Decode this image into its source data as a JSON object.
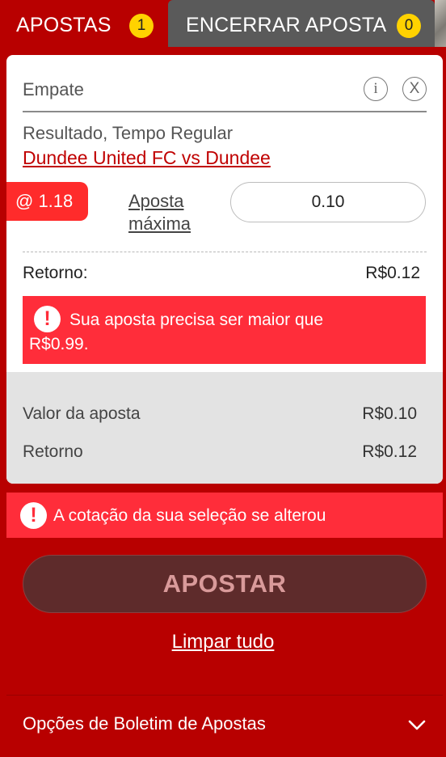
{
  "tabs": [
    {
      "label": "APOSTAS",
      "count": "1"
    },
    {
      "label": "ENCERRAR APOSTA",
      "count": "0"
    }
  ],
  "bet": {
    "selection": "Empate",
    "info_icon": "i",
    "close_icon": "X",
    "market": "Resultado, Tempo Regular",
    "event": "Dundee United FC vs Dundee",
    "odds": "@ 1.18",
    "max_bet_line1": "Aposta",
    "max_bet_line2": "máxima",
    "stake": "0.10",
    "return_label": "Retorno:",
    "return_value": "R$0.12",
    "error_line1": "Sua aposta precisa ser maior que",
    "error_line2": "R$0.99."
  },
  "summary": {
    "stake_label": "Valor da aposta",
    "stake_value": "R$0.10",
    "return_label": "Retorno",
    "return_value": "R$0.12"
  },
  "odds_banner": "A cotação da sua seleção se alterou",
  "place_bet_label": "APOSTAR",
  "clear_all_label": "Limpar tudo",
  "options_label": "Opções de Boletim de Apostas",
  "icons": {
    "exclamation": "!",
    "chevron": "chevron-down-icon",
    "info": "info-icon",
    "close": "close-icon"
  },
  "colors": {
    "brand_red": "#b80000",
    "alert_red": "#ff2d3a",
    "badge_yellow": "#ffd200",
    "inactive_tab": "#5a5a5a",
    "disabled_button": "#5e2b2b"
  }
}
